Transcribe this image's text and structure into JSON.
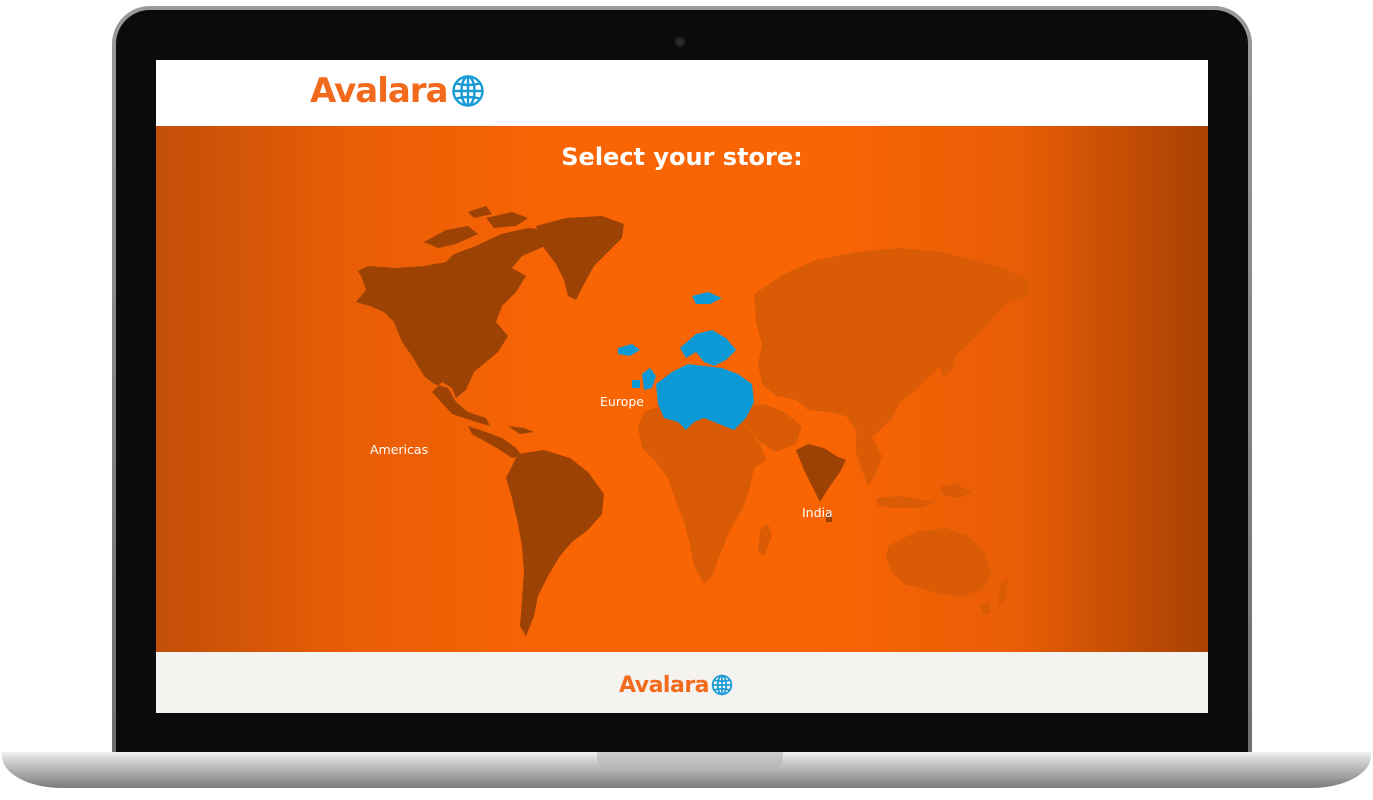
{
  "brand": {
    "name": "Avalara",
    "logo_color": "#f26a1b",
    "globe_color": "#1a9ad6"
  },
  "hero": {
    "title": "Select your store:",
    "background_color": "#fa6504"
  },
  "map": {
    "regions": [
      {
        "id": "americas",
        "label": "Americas",
        "color": "#9c4204"
      },
      {
        "id": "europe",
        "label": "Europe",
        "color": "#0d98d6",
        "selected": true
      },
      {
        "id": "india",
        "label": "India",
        "color": "#9c4204"
      }
    ],
    "inactive_land_color": "#d95b06"
  },
  "icons": {
    "logo_globe": "globe-icon"
  }
}
